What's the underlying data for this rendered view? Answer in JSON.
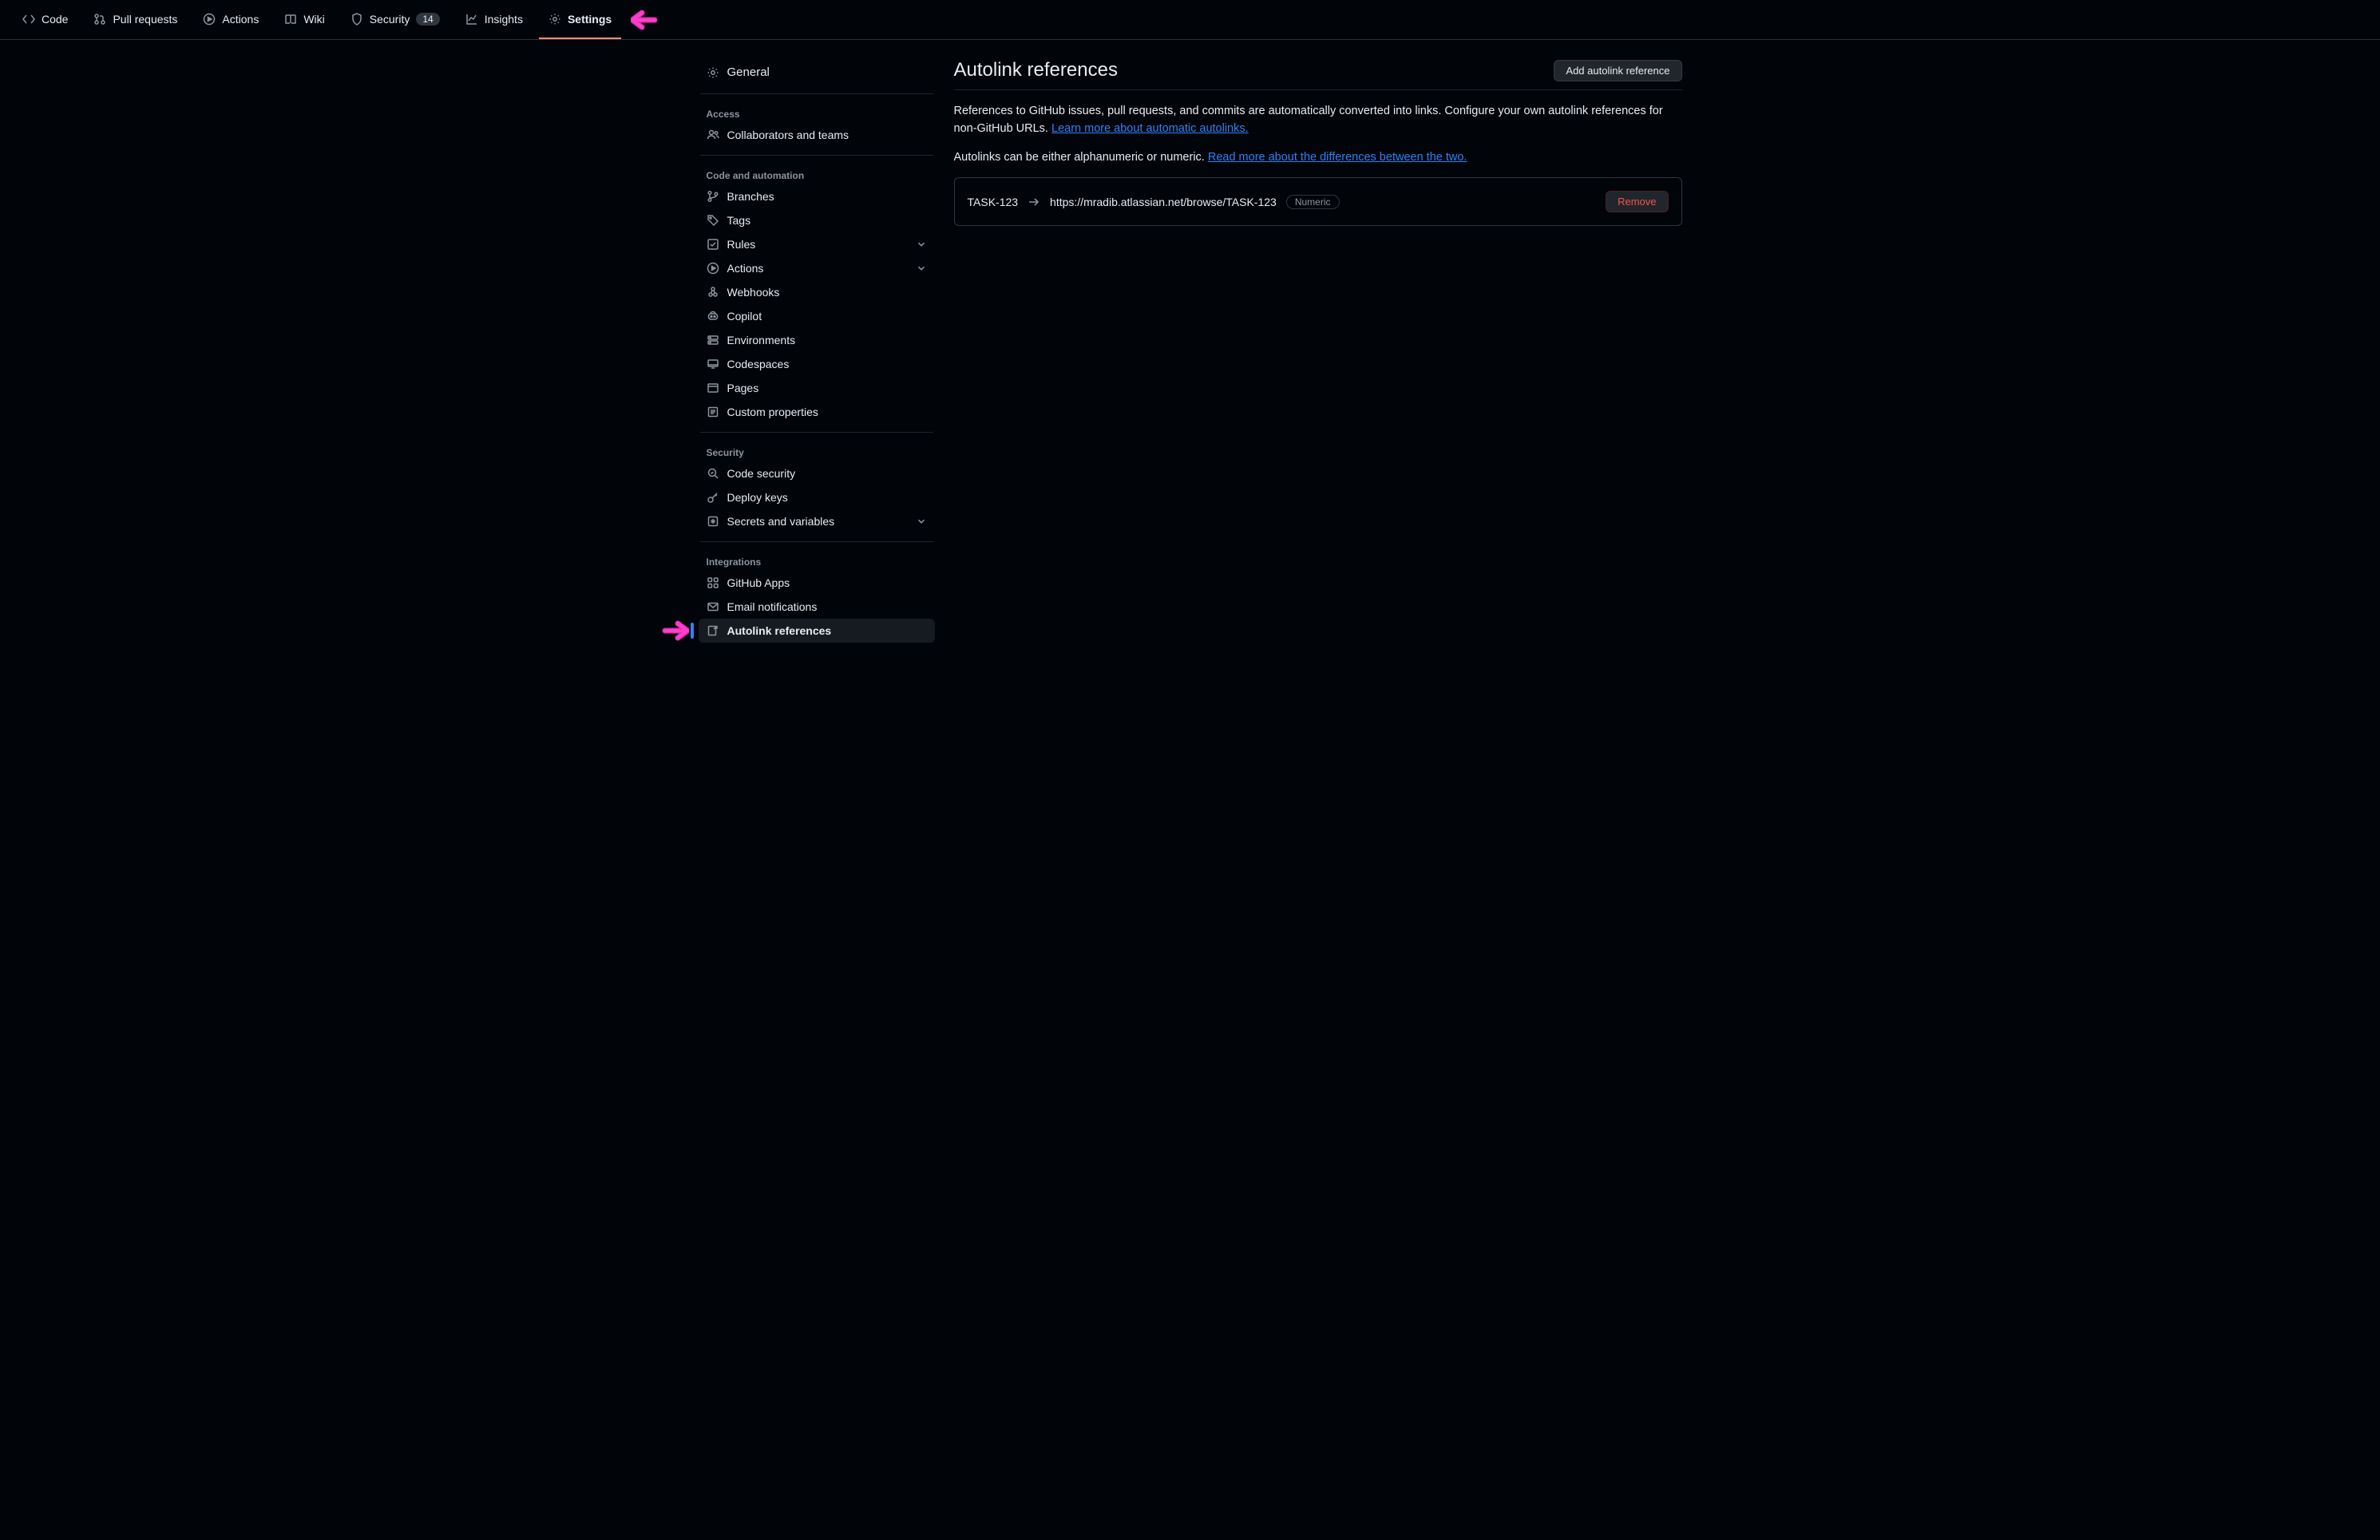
{
  "repoTabs": {
    "code": "Code",
    "pull": "Pull requests",
    "actions": "Actions",
    "wiki": "Wiki",
    "security": "Security",
    "securityCount": "14",
    "insights": "Insights",
    "settings": "Settings"
  },
  "sidebar": {
    "general": "General",
    "groups": {
      "access": {
        "title": "Access",
        "collaborators": "Collaborators and teams"
      },
      "codeAutomation": {
        "title": "Code and automation",
        "branches": "Branches",
        "tags": "Tags",
        "rules": "Rules",
        "actions": "Actions",
        "webhooks": "Webhooks",
        "copilot": "Copilot",
        "environments": "Environments",
        "codespaces": "Codespaces",
        "pages": "Pages",
        "custom": "Custom properties"
      },
      "security": {
        "title": "Security",
        "codeSecurity": "Code security",
        "deployKeys": "Deploy keys",
        "secrets": "Secrets and variables"
      },
      "integrations": {
        "title": "Integrations",
        "ghapps": "GitHub Apps",
        "email": "Email notifications",
        "autolink": "Autolink references"
      }
    }
  },
  "main": {
    "title": "Autolink references",
    "addButton": "Add autolink reference",
    "intro1": "References to GitHub issues, pull requests, and commits are automatically converted into links. Configure your own autolink references for non-GitHub URLs. ",
    "learnLink": "Learn more about automatic autolinks.",
    "intro2": "Autolinks can be either alphanumeric or numeric. ",
    "readLink": "Read more about the differences between the two.",
    "entry": {
      "prefix": "TASK-123",
      "url": "https://mradib.atlassian.net/browse/TASK-123",
      "chip": "Numeric",
      "remove": "Remove"
    }
  }
}
